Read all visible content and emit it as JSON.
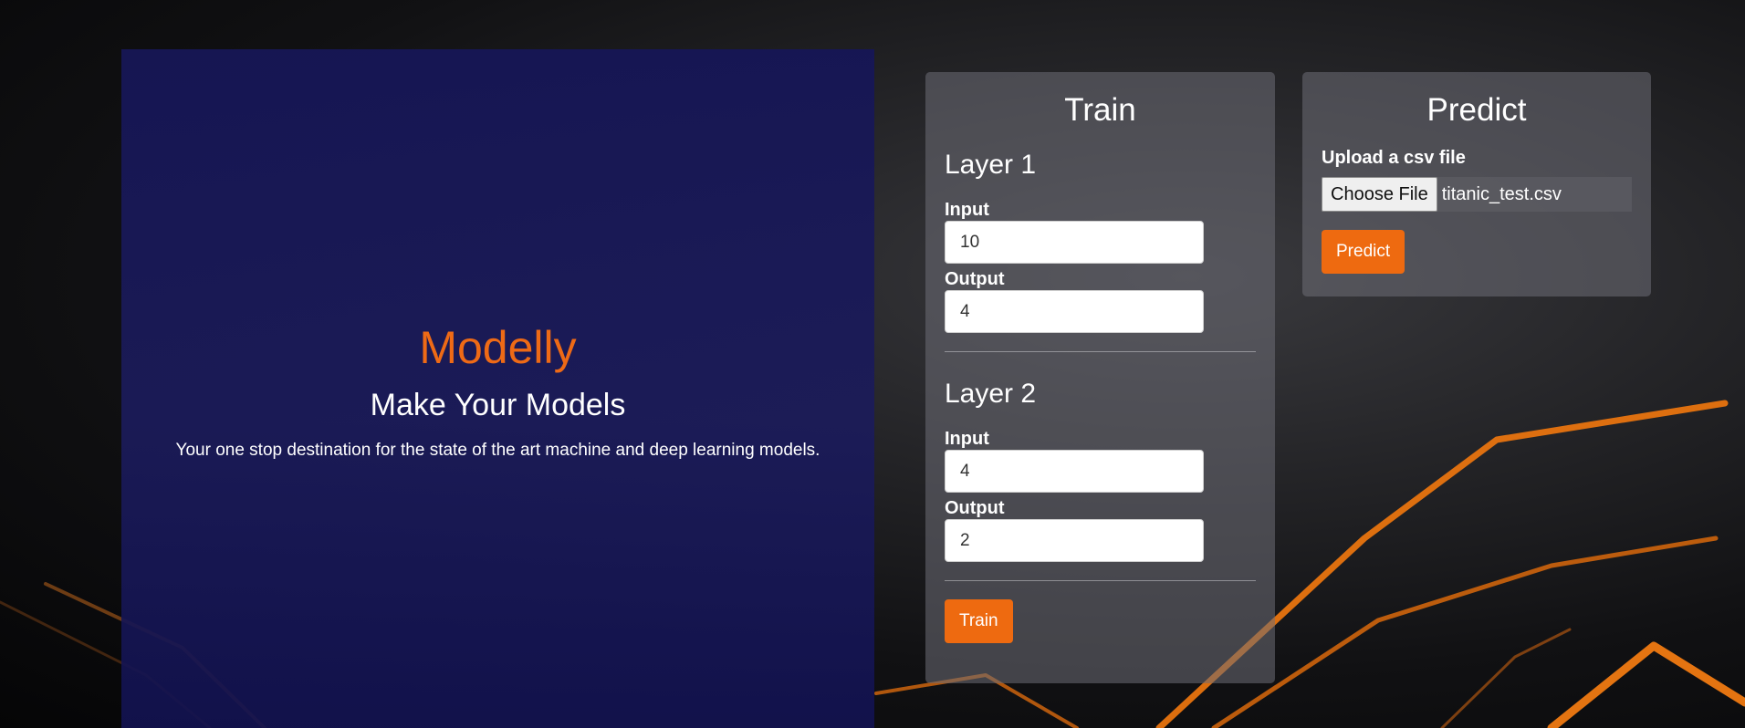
{
  "hero": {
    "brand": "Modelly",
    "tagline": "Make Your Models",
    "description": "Your one stop destination for the state of the art machine and deep learning models."
  },
  "train": {
    "title": "Train",
    "layers": [
      {
        "title": "Layer 1",
        "input_label": "Input",
        "input_value": "10",
        "output_label": "Output",
        "output_value": "4"
      },
      {
        "title": "Layer 2",
        "input_label": "Input",
        "input_value": "4",
        "output_label": "Output",
        "output_value": "2"
      }
    ],
    "button_label": "Train"
  },
  "predict": {
    "title": "Predict",
    "upload_label": "Upload a csv file",
    "choose_file_label": "Choose File",
    "file_name": "titanic_test.csv",
    "button_label": "Predict"
  },
  "colors": {
    "accent": "#ee6a10",
    "hero_background": "#16165a"
  }
}
